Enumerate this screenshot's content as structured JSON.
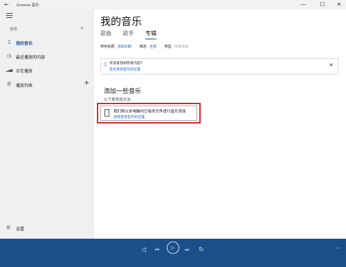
{
  "titlebar": {
    "back_glyph": "←",
    "app_title": "Groove 音乐",
    "minimize_glyph": "—",
    "maximize_glyph": "☐",
    "close_glyph": "✕"
  },
  "sidebar": {
    "search_placeholder": "搜索",
    "search_icon": "⌕",
    "items": [
      {
        "label": "我的音乐",
        "icon": "♫",
        "icon_name": "music-note-icon",
        "active": true
      },
      {
        "label": "最近播放的内容",
        "icon": "◷",
        "icon_name": "clock-icon",
        "active": false
      },
      {
        "label": "正在播放",
        "icon": "▂▄▆",
        "icon_name": "equalizer-icon",
        "active": false
      },
      {
        "label": "播放列表",
        "icon": "☰",
        "icon_name": "playlist-icon",
        "active": false
      }
    ],
    "add_playlist_glyph": "+",
    "settings_label": "设置",
    "settings_icon": "⚙"
  },
  "main": {
    "title": "我的音乐",
    "tabs": [
      {
        "label": "歌曲",
        "active": false
      },
      {
        "label": "歌手",
        "active": false
      },
      {
        "label": "专辑",
        "active": true
      }
    ],
    "filters": {
      "sort_label": "排序依据:",
      "sort_value": "添加日期",
      "filter_label": "筛选:",
      "filter_value": "全部",
      "type_label": "类型:",
      "type_value": "所有流派"
    },
    "notice": {
      "title": "并没有找到所有内容?",
      "link": "显示查找音乐的位置",
      "close_glyph": "✕",
      "icon": "▯"
    },
    "add_section": {
      "title": "添加一些音乐",
      "subtitle": "以下是添加方法:",
      "card_title": "我们将以本电脑内已有的文件进行音乐添加",
      "card_link": "选择查找音乐的位置。"
    }
  },
  "player": {
    "shuffle": "⤨",
    "previous": "⏮",
    "play": "▷",
    "next": "⏭",
    "repeat": "↻",
    "more": "⋯"
  },
  "colors": {
    "accent": "#1a4f8a",
    "link": "#1565c0",
    "highlight_border": "#d9262b"
  }
}
